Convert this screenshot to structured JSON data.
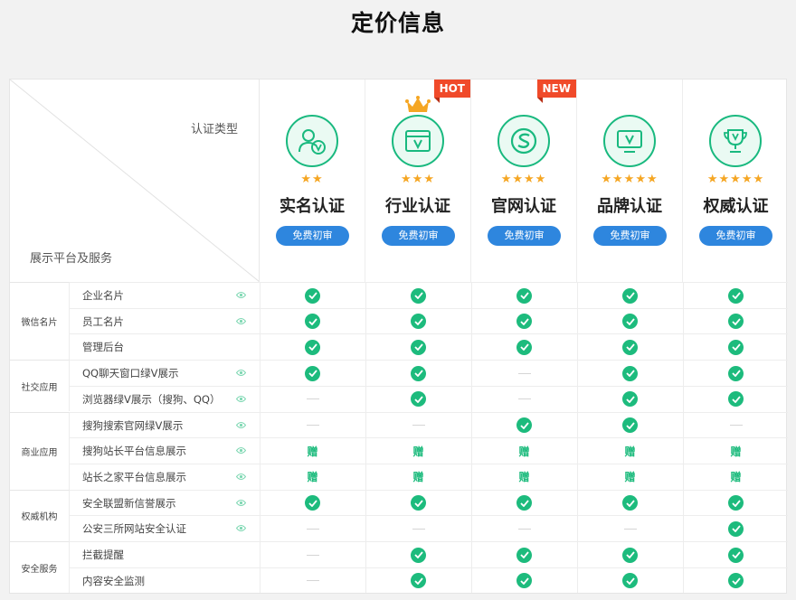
{
  "page": {
    "title": "定价信息"
  },
  "header": {
    "type_label": "认证类型",
    "service_label": "展示平台及服务"
  },
  "plans": [
    {
      "name": "实名认证",
      "stars": "★★",
      "button": "免费初审",
      "icon": "user-v-icon"
    },
    {
      "name": "行业认证",
      "stars": "★★★",
      "button": "免费初审",
      "icon": "browser-v-icon",
      "badge": "HOT",
      "crown": true
    },
    {
      "name": "官网认证",
      "stars": "★★★★",
      "button": "免费初审",
      "icon": "sogou-s-icon",
      "badge": "NEW"
    },
    {
      "name": "品牌认证",
      "stars": "★★★★★",
      "button": "免费初审",
      "icon": "monitor-v-icon"
    },
    {
      "name": "权威认证",
      "stars": "★★★★★",
      "button": "免费初审",
      "icon": "trophy-v-icon"
    }
  ],
  "categories": [
    {
      "name": "微信名片",
      "count": 3
    },
    {
      "name": "社交应用",
      "count": 2
    },
    {
      "name": "商业应用",
      "count": 3
    },
    {
      "name": "权威机构",
      "count": 2
    },
    {
      "name": "安全服务",
      "count": 2
    }
  ],
  "gift_text": "赠",
  "rows": [
    {
      "service": "企业名片",
      "eye": true,
      "cells": [
        "check",
        "check",
        "check",
        "check",
        "check"
      ]
    },
    {
      "service": "员工名片",
      "eye": true,
      "cells": [
        "check",
        "check",
        "check",
        "check",
        "check"
      ]
    },
    {
      "service": "管理后台",
      "eye": false,
      "cells": [
        "check",
        "check",
        "check",
        "check",
        "check"
      ]
    },
    {
      "service": "QQ聊天窗口绿V展示",
      "eye": true,
      "cells": [
        "check",
        "check",
        "dash",
        "check",
        "check"
      ]
    },
    {
      "service": "浏览器绿V展示（搜狗、QQ）",
      "eye": true,
      "cells": [
        "dash",
        "check",
        "dash",
        "check",
        "check"
      ]
    },
    {
      "service": "搜狗搜索官网绿V展示",
      "eye": true,
      "cells": [
        "dash",
        "dash",
        "check",
        "check",
        "dash"
      ]
    },
    {
      "service": "搜狗站长平台信息展示",
      "eye": true,
      "cells": [
        "gift",
        "gift",
        "gift",
        "gift",
        "gift"
      ]
    },
    {
      "service": "站长之家平台信息展示",
      "eye": true,
      "cells": [
        "gift",
        "gift",
        "gift",
        "gift",
        "gift"
      ]
    },
    {
      "service": "安全联盟新信誉展示",
      "eye": true,
      "cells": [
        "check",
        "check",
        "check",
        "check",
        "check"
      ]
    },
    {
      "service": "公安三所网站安全认证",
      "eye": true,
      "cells": [
        "dash",
        "dash",
        "dash",
        "dash",
        "check"
      ]
    },
    {
      "service": "拦截提醒",
      "eye": false,
      "cells": [
        "dash",
        "check",
        "check",
        "check",
        "check"
      ]
    },
    {
      "service": "内容安全监测",
      "eye": false,
      "cells": [
        "dash",
        "check",
        "check",
        "check",
        "check"
      ]
    }
  ],
  "colors": {
    "accent": "#1dbb7d",
    "button": "#2e86de",
    "badge": "#f04a2a",
    "star": "#f5a623"
  }
}
